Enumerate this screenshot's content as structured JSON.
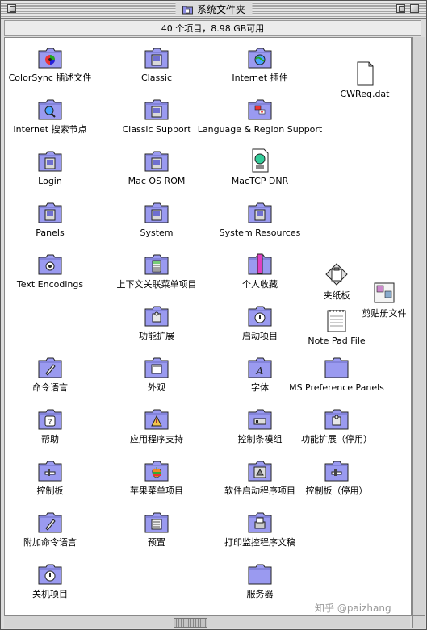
{
  "window": {
    "title": "系统文件夹",
    "status": "40 个项目，8.98 GB可用"
  },
  "items": [
    {
      "label": "ColorSync 插述文件",
      "icon": "colorsync-folder-icon",
      "badge": "colorsync"
    },
    {
      "label": "Classic",
      "icon": "classic-folder-icon",
      "badge": "mac"
    },
    {
      "label": "Internet 插件",
      "icon": "internet-plugins-folder-icon",
      "badge": "globe"
    },
    {
      "label": "CWReg.dat",
      "icon": "document-file-icon",
      "badge": "doc"
    },
    {
      "label": "Internet 搜索节点",
      "icon": "internet-search-folder-icon",
      "badge": "search"
    },
    {
      "label": "Classic Support",
      "icon": "classic-support-folder-icon",
      "badge": "mac"
    },
    {
      "label": "Language & Region Support",
      "icon": "language-region-folder-icon",
      "badge": "flags"
    },
    {
      "label": "Login",
      "icon": "login-folder-icon",
      "badge": "mac"
    },
    {
      "label": "Mac OS ROM",
      "icon": "mac-os-rom-icon",
      "badge": "mac"
    },
    {
      "label": "MacTCP DNR",
      "icon": "mactcp-dnr-icon",
      "badge": "globe-doc"
    },
    {
      "label": "Panels",
      "icon": "panels-folder-icon",
      "badge": "mac"
    },
    {
      "label": "System",
      "icon": "system-suitcase-icon",
      "badge": "mac"
    },
    {
      "label": "System Resources",
      "icon": "system-resources-folder-icon",
      "badge": "mac"
    },
    {
      "label": "Text Encodings",
      "icon": "text-encodings-folder-icon",
      "badge": "gear"
    },
    {
      "label": "上下文关联菜单项目",
      "icon": "contextual-menu-folder-icon",
      "badge": "calc"
    },
    {
      "label": "个人收藏",
      "icon": "favorites-folder-icon",
      "badge": "bookmark"
    },
    {
      "label": "夹纸板",
      "icon": "clipboard-icon",
      "badge": "clipboard"
    },
    {
      "label": "剪贴册文件",
      "icon": "scrapbook-icon",
      "badge": "scrap"
    },
    {
      "label": "功能扩展",
      "icon": "extensions-folder-icon",
      "badge": "puzzle"
    },
    {
      "label": "启动项目",
      "icon": "startup-items-folder-icon",
      "badge": "power"
    },
    {
      "label": "Note Pad File",
      "icon": "note-pad-file-icon",
      "badge": "notepad"
    },
    {
      "label": "命令语言",
      "icon": "scripting-additions-folder-icon",
      "badge": "script"
    },
    {
      "label": "外观",
      "icon": "appearance-folder-icon",
      "badge": "window"
    },
    {
      "label": "字体",
      "icon": "fonts-folder-icon",
      "badge": "font"
    },
    {
      "label": "MS Preference Panels",
      "icon": "ms-preference-panels-folder-icon",
      "badge": "none"
    },
    {
      "label": "帮助",
      "icon": "help-folder-icon",
      "badge": "help"
    },
    {
      "label": "应用程序支持",
      "icon": "application-support-folder-icon",
      "badge": "app"
    },
    {
      "label": "控制条模组",
      "icon": "control-strip-modules-folder-icon",
      "badge": "strip"
    },
    {
      "label": "功能扩展（停用）",
      "icon": "extensions-disabled-folder-icon",
      "badge": "puzzle"
    },
    {
      "label": "控制板",
      "icon": "control-panels-folder-icon",
      "badge": "slider"
    },
    {
      "label": "苹果菜单项目",
      "icon": "apple-menu-items-folder-icon",
      "badge": "apple"
    },
    {
      "label": "软件启动程序项目",
      "icon": "launcher-items-folder-icon",
      "badge": "launcher"
    },
    {
      "label": "控制板（停用）",
      "icon": "control-panels-disabled-folder-icon",
      "badge": "slider"
    },
    {
      "label": "附加命令语言",
      "icon": "scripting-extra-folder-icon",
      "badge": "script"
    },
    {
      "label": "预置",
      "icon": "preferences-folder-icon",
      "badge": "prefs"
    },
    {
      "label": "打印监控程序文稿",
      "icon": "printmonitor-documents-folder-icon",
      "badge": "print"
    },
    {
      "label": "关机项目",
      "icon": "shutdown-items-folder-icon",
      "badge": "power"
    },
    {
      "label": "服务器",
      "icon": "servers-folder-icon",
      "badge": "none"
    }
  ],
  "watermark": "知乎 @paizhang"
}
